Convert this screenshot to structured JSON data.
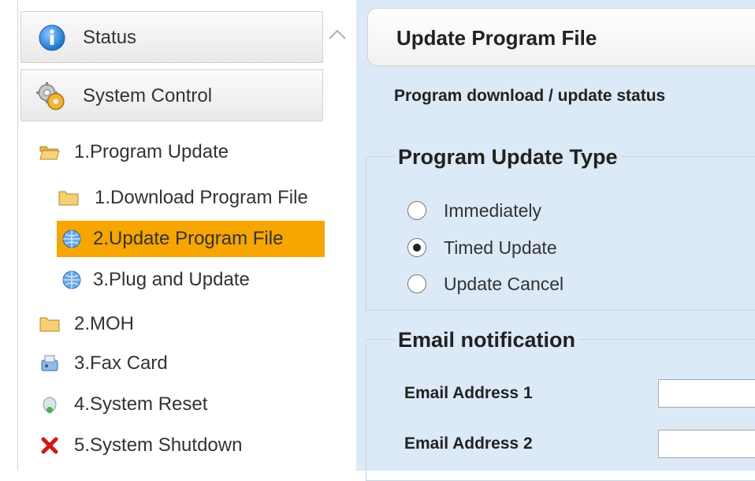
{
  "sidebar": {
    "panels": [
      {
        "label": "Status",
        "icon": "info-icon"
      },
      {
        "label": "System Control",
        "icon": "gears-icon"
      }
    ],
    "tree": [
      {
        "label": "1.Program Update",
        "icon": "folder-open-icon"
      },
      {
        "label": "1.Download Program File",
        "icon": "folder-icon"
      },
      {
        "label": "2.Update Program File",
        "icon": "globe-icon",
        "selected": true
      },
      {
        "label": "3.Plug and Update",
        "icon": "globe-icon"
      },
      {
        "label": "2.MOH",
        "icon": "folder-icon"
      },
      {
        "label": "3.Fax Card",
        "icon": "fax-icon"
      },
      {
        "label": "4.System Reset",
        "icon": "reset-icon"
      },
      {
        "label": "5.System Shutdown",
        "icon": "shutdown-x-icon"
      }
    ]
  },
  "main": {
    "title": "Update Program File",
    "status_text": "Program download / update status",
    "update_type": {
      "legend": "Program Update Type",
      "options": [
        {
          "label": "Immediately",
          "checked": false
        },
        {
          "label": "Timed Update",
          "checked": true
        },
        {
          "label": "Update Cancel",
          "checked": false
        }
      ]
    },
    "email": {
      "legend": "Email notification",
      "fields": [
        {
          "label": "Email Address 1",
          "value": ""
        },
        {
          "label": "Email Address 2",
          "value": ""
        }
      ]
    }
  },
  "colors": {
    "selected_bg": "#f7a500",
    "content_bg": "#dce9f7",
    "shutdown_red": "#d01818"
  }
}
